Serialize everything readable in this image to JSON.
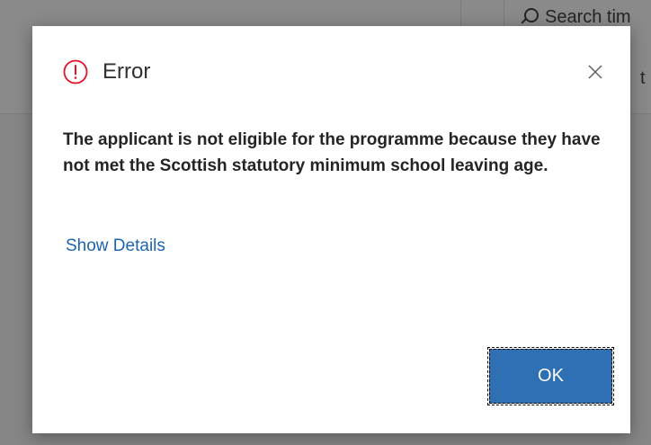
{
  "background": {
    "search_label": "Search tim",
    "partial_text": "t"
  },
  "dialog": {
    "title": "Error",
    "message": "The applicant is not eligible for the programme because they have not met the Scottish statutory minimum school leaving age.",
    "show_details_label": "Show Details",
    "ok_label": "OK",
    "close_icon": "close-icon",
    "status_icon": "error-icon"
  },
  "colors": {
    "error_red": "#e81123",
    "link_blue": "#1d63b3",
    "primary_button": "#2f6fb4",
    "overlay_gray": "#868686"
  }
}
